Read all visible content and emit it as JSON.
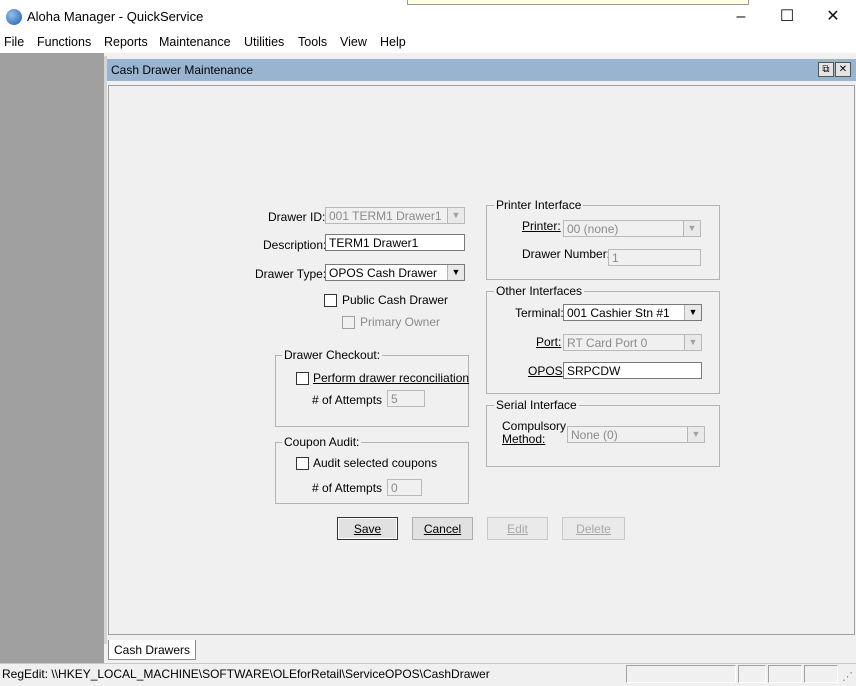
{
  "window": {
    "title": "Aloha Manager - QuickService",
    "controls": {
      "minimize": "–",
      "maximize": "☐",
      "close": "✕"
    }
  },
  "menu": [
    "File",
    "Functions",
    "Reports",
    "Maintenance",
    "Utilities",
    "Tools",
    "View",
    "Help"
  ],
  "child_window": {
    "title": "Cash Drawer Maintenance",
    "restore": "⧉",
    "close": "✕"
  },
  "form": {
    "drawer_id": {
      "label": "Drawer ID:",
      "value": "001 TERM1 Drawer1"
    },
    "description": {
      "label": "Description:",
      "value": "TERM1 Drawer1"
    },
    "drawer_type": {
      "label": "Drawer Type:",
      "value": "OPOS Cash Drawer"
    },
    "public_cash_drawer": {
      "label": "Public Cash Drawer",
      "checked": false
    },
    "primary_owner": {
      "label": "Primary Owner",
      "checked": false
    },
    "drawer_checkout": {
      "title": "Drawer Checkout:",
      "perform_reconciliation": {
        "label": "Perform drawer reconciliation",
        "checked": false
      },
      "attempts_label": "# of Attempts",
      "attempts_value": "5"
    },
    "coupon_audit": {
      "title": "Coupon Audit:",
      "audit_selected": {
        "label": "Audit selected coupons",
        "checked": false
      },
      "attempts_label": "# of Attempts",
      "attempts_value": "0"
    },
    "printer_interface": {
      "title": "Printer Interface",
      "printer_label": "Printer:",
      "printer_value": "00 (none)",
      "drawer_number_label": "Drawer Number:",
      "drawer_number_value": "1"
    },
    "other_interfaces": {
      "title": "Other Interfaces",
      "terminal_label": "Terminal:",
      "terminal_value": "001 Cashier Stn #1",
      "port_label": "Port:",
      "port_value": "RT Card Port 0",
      "opos_label": "OPOS",
      "opos_value": "SRPCDW"
    },
    "serial_interface": {
      "title": "Serial Interface",
      "compulsory_label_1": "Compulsory",
      "compulsory_label_2": "Method:",
      "compulsory_value": "None (0)"
    }
  },
  "buttons": {
    "save": "Save",
    "cancel": "Cancel",
    "edit": "Edit",
    "delete": "Delete"
  },
  "tabs": [
    "Cash Drawers"
  ],
  "statusbar": {
    "text": "RegEdit: \\\\HKEY_LOCAL_MACHINE\\SOFTWARE\\OLEforRetail\\ServiceOPOS\\CashDrawer"
  },
  "icons": {
    "dropdown": "▼",
    "app": "aloha-app-icon"
  }
}
